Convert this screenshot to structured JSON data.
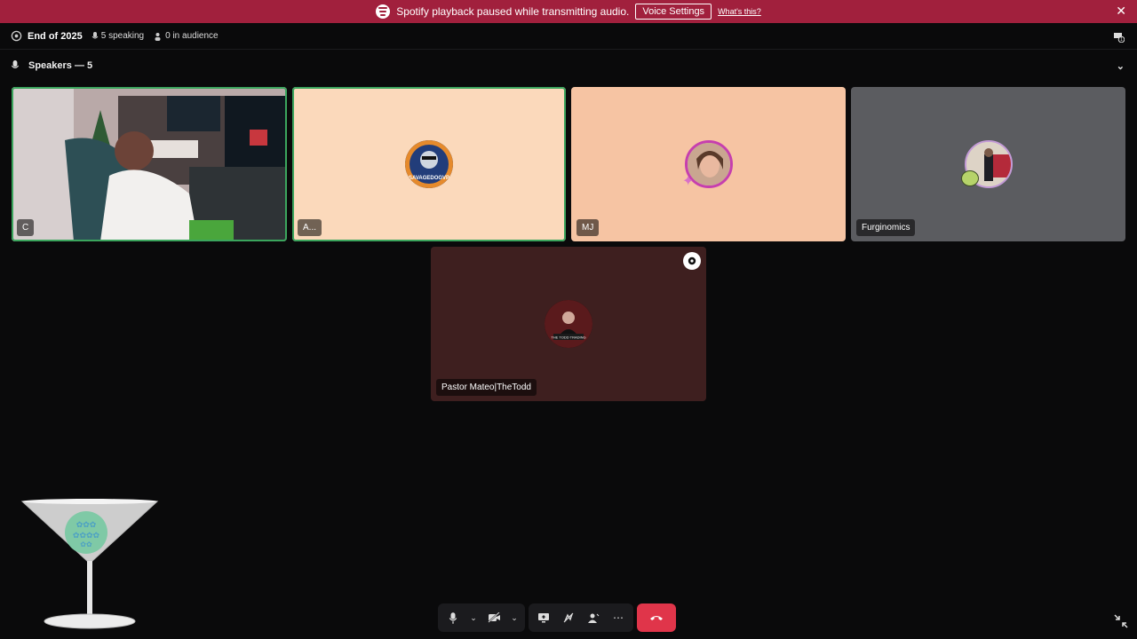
{
  "banner": {
    "message": "Spotify playback paused while transmitting audio.",
    "button_label": "Voice Settings",
    "link_label": "What's this?",
    "icon": "spotify-icon",
    "color": "#a1203d"
  },
  "topbar": {
    "title": "End of 2025",
    "speaking": "5 speaking",
    "audience": "0 in audience",
    "inbox_count": "1"
  },
  "section": {
    "label": "Speakers — 5"
  },
  "tiles": [
    {
      "name": "C",
      "type": "video",
      "speaking": true
    },
    {
      "name": "A...",
      "type": "avatar",
      "speaking": true,
      "bg": "#fbd9bb"
    },
    {
      "name": "MJ",
      "type": "avatar",
      "speaking": false,
      "bg": "#f6c4a3"
    },
    {
      "name": "Furginomics",
      "type": "avatar",
      "speaking": false,
      "bg": "#5b5c60"
    },
    {
      "name": "Pastor Mateo|TheTodd",
      "type": "avatar",
      "speaking": false,
      "bg": "#3e1f1f"
    }
  ],
  "avatar_texts": {
    "savage": "SAVAGEDOGVP",
    "todd": "THE TODD TRADING"
  },
  "toolbar": {
    "icons": [
      "microphone-icon",
      "chevron-down-icon",
      "camera-off-icon",
      "chevron-down-icon",
      "screen-share-icon",
      "activity-off-icon",
      "soundboard-icon",
      "more-icon",
      "hang-up-icon"
    ]
  },
  "accent": {
    "speaking_outline": "#3ba55d",
    "hangup": "#e0354a"
  }
}
